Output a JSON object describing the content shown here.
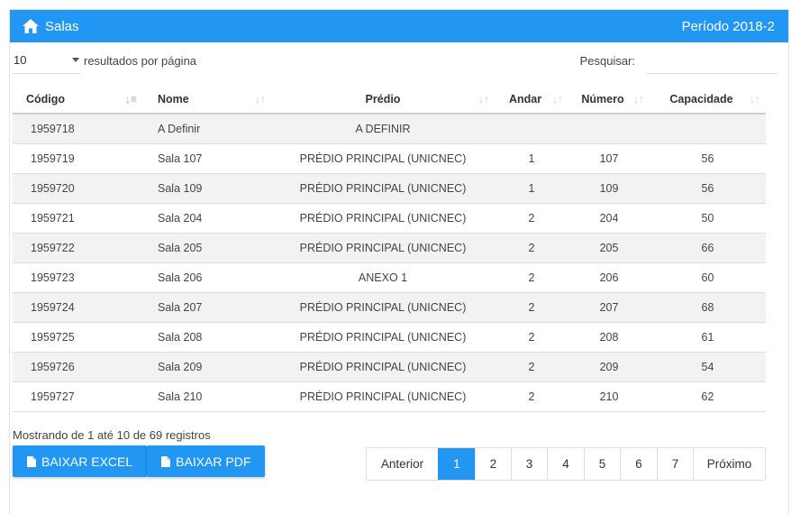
{
  "header": {
    "title": "Salas",
    "period": "Período 2018-2",
    "home_icon": "home-icon"
  },
  "controls": {
    "length_value": "10",
    "length_label": "resultados por página",
    "search_label": "Pesquisar:",
    "search_value": ""
  },
  "table": {
    "columns": [
      "Código",
      "Nome",
      "Prédio",
      "Andar",
      "Número",
      "Capacidade"
    ],
    "rows": [
      [
        "1959718",
        "A Definir",
        "A DEFINIR",
        "",
        "",
        ""
      ],
      [
        "1959719",
        "Sala 107",
        "PRÉDIO PRINCIPAL (UNICNEC)",
        "1",
        "107",
        "56"
      ],
      [
        "1959720",
        "Sala 109",
        "PRÉDIO PRINCIPAL (UNICNEC)",
        "1",
        "109",
        "56"
      ],
      [
        "1959721",
        "Sala 204",
        "PRÉDIO PRINCIPAL (UNICNEC)",
        "2",
        "204",
        "50"
      ],
      [
        "1959722",
        "Sala 205",
        "PRÉDIO PRINCIPAL (UNICNEC)",
        "2",
        "205",
        "66"
      ],
      [
        "1959723",
        "Sala 206",
        "ANEXO 1",
        "2",
        "206",
        "60"
      ],
      [
        "1959724",
        "Sala 207",
        "PRÉDIO PRINCIPAL (UNICNEC)",
        "2",
        "207",
        "68"
      ],
      [
        "1959725",
        "Sala 208",
        "PRÉDIO PRINCIPAL (UNICNEC)",
        "2",
        "208",
        "61"
      ],
      [
        "1959726",
        "Sala 209",
        "PRÉDIO PRINCIPAL (UNICNEC)",
        "2",
        "209",
        "54"
      ],
      [
        "1959727",
        "Sala 210",
        "PRÉDIO PRINCIPAL (UNICNEC)",
        "2",
        "210",
        "62"
      ]
    ]
  },
  "footer": {
    "info": "Mostrando de 1 até 10 de 69 registros",
    "excel_label": "BAIXAR EXCEL",
    "pdf_label": "BAIXAR PDF"
  },
  "pagination": {
    "prev": "Anterior",
    "pages": [
      "1",
      "2",
      "3",
      "4",
      "5",
      "6",
      "7"
    ],
    "active": "1",
    "next": "Próximo"
  },
  "colors": {
    "accent": "#2196f3"
  }
}
